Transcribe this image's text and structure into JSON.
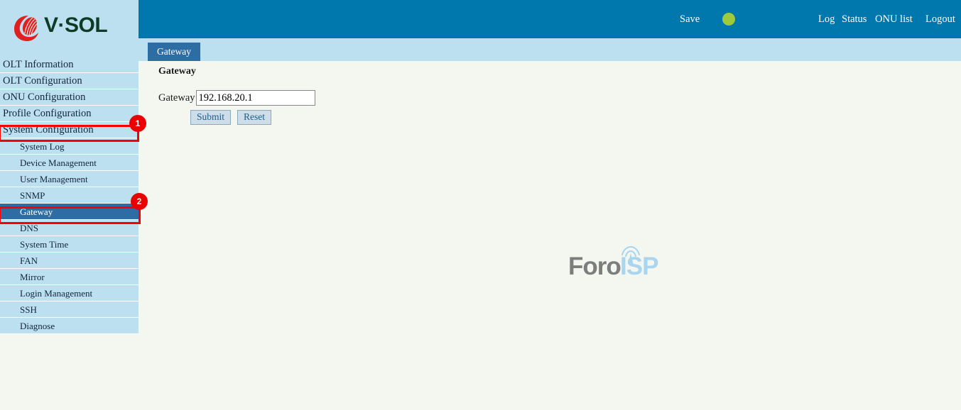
{
  "brand": {
    "name": "V·SOL",
    "logo_icon": "vsol-swirl-logo"
  },
  "header": {
    "save_label": "Save",
    "status_indicator_color": "#9fca3c",
    "links": [
      {
        "label": "Log"
      },
      {
        "label": "Status"
      },
      {
        "label": "ONU list"
      },
      {
        "label": "Logout"
      }
    ]
  },
  "tabs": [
    {
      "label": "Gateway",
      "active": true
    }
  ],
  "sidebar": {
    "items": [
      {
        "label": "OLT Information",
        "level": "top",
        "selected": false
      },
      {
        "label": "OLT Configuration",
        "level": "top",
        "selected": false
      },
      {
        "label": "ONU Configuration",
        "level": "top",
        "selected": false
      },
      {
        "label": "Profile Configuration",
        "level": "top",
        "selected": false
      },
      {
        "label": "System Configuration",
        "level": "top",
        "selected": false
      },
      {
        "label": "System Log",
        "level": "sub",
        "selected": false
      },
      {
        "label": "Device Management",
        "level": "sub",
        "selected": false
      },
      {
        "label": "User Management",
        "level": "sub",
        "selected": false
      },
      {
        "label": "SNMP",
        "level": "sub",
        "selected": false
      },
      {
        "label": "Gateway",
        "level": "sub",
        "selected": true
      },
      {
        "label": "DNS",
        "level": "sub",
        "selected": false
      },
      {
        "label": "System Time",
        "level": "sub",
        "selected": false
      },
      {
        "label": "FAN",
        "level": "sub",
        "selected": false
      },
      {
        "label": "Mirror",
        "level": "sub",
        "selected": false
      },
      {
        "label": "Login Management",
        "level": "sub",
        "selected": false
      },
      {
        "label": "SSH",
        "level": "sub",
        "selected": false
      },
      {
        "label": "Diagnose",
        "level": "sub",
        "selected": false
      }
    ]
  },
  "main": {
    "section_title": "Gateway",
    "form": {
      "gateway_label": "Gateway",
      "gateway_value": "192.168.20.1",
      "gateway_placeholder": "",
      "submit_label": "Submit",
      "reset_label": "Reset"
    }
  },
  "watermark": {
    "part1": "Foro",
    "part2": "ISP",
    "icon": "broadcast-tower-icon"
  },
  "annotations": [
    {
      "number": "1",
      "target": "System Configuration"
    },
    {
      "number": "2",
      "target": "Gateway"
    }
  ],
  "colors": {
    "header_blue": "#0077ad",
    "sidebar_blue": "#bde0f0",
    "selected_blue": "#2e6da4",
    "annotation_red": "#f90000",
    "content_bg": "#f4f6f0"
  }
}
